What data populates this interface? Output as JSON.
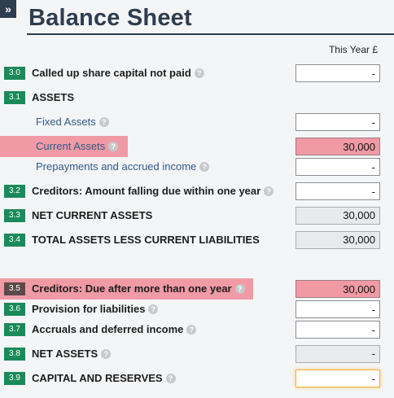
{
  "expand_glyph": "»",
  "title": "Balance Sheet",
  "column_header": "This Year £",
  "colors": {
    "badge_green": "#1b8a5a",
    "highlight_red": "#f09aa6",
    "focus_orange": "#f3b13a",
    "navy": "#2e3d4f"
  },
  "rows": {
    "r30": {
      "badge": "3.0",
      "label": "Called up share capital not paid",
      "value": "-"
    },
    "r31": {
      "badge": "3.1",
      "label": "ASSETS"
    },
    "fixed": {
      "label": "Fixed Assets",
      "value": "-"
    },
    "current": {
      "label": "Current Assets",
      "value": "30,000"
    },
    "prepay": {
      "label": "Prepayments and accrued income",
      "value": "-"
    },
    "r32": {
      "badge": "3.2",
      "label": "Creditors: Amount falling due within one year",
      "value": "-"
    },
    "r33": {
      "badge": "3.3",
      "label": "NET CURRENT ASSETS",
      "value": "30,000"
    },
    "r34": {
      "badge": "3.4",
      "label": "TOTAL ASSETS LESS CURRENT LIABILITIES",
      "value": "30,000"
    },
    "r35": {
      "badge": "3.5",
      "label": "Creditors: Due after more than one year",
      "value": "30,000"
    },
    "r36": {
      "badge": "3.6",
      "label": "Provision for liabilities",
      "value": "-"
    },
    "r37": {
      "badge": "3.7",
      "label": "Accruals and deferred income",
      "value": "-"
    },
    "r38": {
      "badge": "3.8",
      "label": "NET ASSETS",
      "value": "-"
    },
    "r39": {
      "badge": "3.9",
      "label": "CAPITAL AND RESERVES",
      "value": "-"
    }
  },
  "help_glyph": "?"
}
